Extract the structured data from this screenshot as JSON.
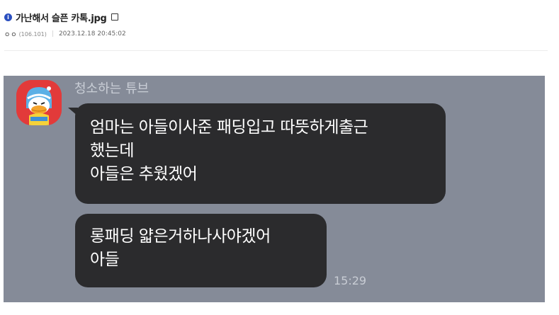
{
  "post": {
    "title_icon": "info-circle-icon",
    "title": "가난해서 슬픈 카톡.jpg",
    "title_badge_icon": "image-square-icon",
    "author": "ㅇㅇ",
    "ip": "(106.101)",
    "separator": "|",
    "date": "2023.12.18 20:45:02"
  },
  "chat": {
    "background_color": "#858b98",
    "avatar_icon": "duck-avatar-icon",
    "sender_name": "청소하는 튜브",
    "messages": [
      {
        "lines": [
          "엄마는 아들이사준 패딩입고 따뜻하게출근",
          "했는데",
          "아들은 추웠겠어"
        ]
      },
      {
        "lines": [
          "롱패딩 얇은거하나사야겠어",
          "아들"
        ]
      }
    ],
    "time": "15:29"
  }
}
